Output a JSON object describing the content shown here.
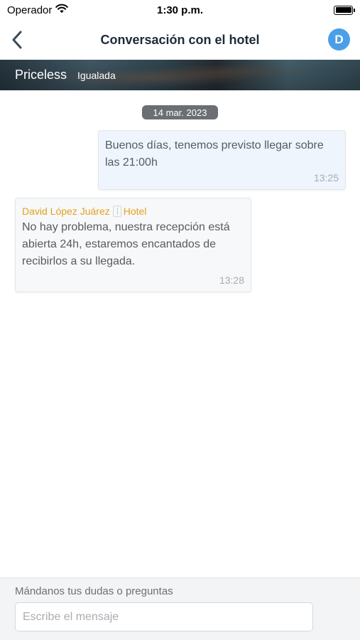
{
  "status_bar": {
    "carrier": "Operador",
    "time": "1:30 p.m.",
    "icons": [
      "wifi-icon",
      "battery-icon"
    ]
  },
  "nav": {
    "title": "Conversación con el hotel",
    "back_icon": "chevron-left-icon",
    "avatar_initial": "D",
    "accent_color": "#4a9fe8"
  },
  "hotel": {
    "name": "Priceless",
    "city": "Igualada"
  },
  "chat": {
    "date": "14 mar. 2023",
    "messages": [
      {
        "direction": "outgoing",
        "text": "Buenos días, tenemos previsto llegar sobre las 21:00h",
        "time": "13:25"
      },
      {
        "direction": "incoming",
        "sender": "David López Juárez",
        "sender_role": "Hotel",
        "sender_color": "#e2a11c",
        "text": "No hay problema, nuestra recepción está abierta 24h, estaremos encantados de recibirlos a su llegada.",
        "time": "13:28"
      }
    ]
  },
  "composer": {
    "label": "Mándanos tus dudas o preguntas",
    "placeholder": "Escribe el mensaje",
    "value": ""
  }
}
